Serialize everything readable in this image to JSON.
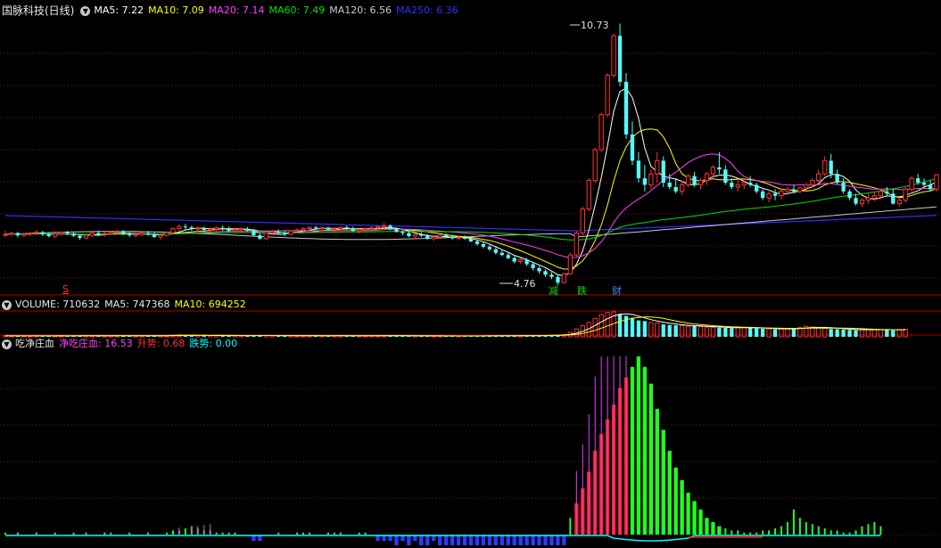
{
  "price_panel": {
    "stock_name": "国脉科技(日线)",
    "indicators": [
      {
        "label": "MA5: 7.22",
        "color": "#ffffff"
      },
      {
        "label": "MA10: 7.09",
        "color": "#ffff00"
      },
      {
        "label": "MA20: 7.14",
        "color": "#ff40ff"
      },
      {
        "label": "MA60: 7.49",
        "color": "#00e000"
      },
      {
        "label": "MA120: 6.56",
        "color": "#c8c8c8"
      },
      {
        "label": "MA250: 6.36",
        "color": "#3030ff"
      }
    ],
    "high_label": "10.73",
    "low_label": "4.76",
    "markers": {
      "s_mark": "S",
      "jian": "减",
      "die": "跌",
      "cai": "财"
    }
  },
  "volume_panel": {
    "indicators": [
      {
        "label": "VOLUME: 710632",
        "color": "#ffffff"
      },
      {
        "label": "MA5: 747368",
        "color": "#ffffff"
      },
      {
        "label": "MA10: 694252",
        "color": "#ffff00"
      }
    ]
  },
  "indicator_panel": {
    "name": "吃净庄血",
    "indicators": [
      {
        "label": "净吃庄血: 16.53",
        "color": "#ff40ff"
      },
      {
        "label": "升势: 0.68",
        "color": "#ff3030"
      },
      {
        "label": "跌势: 0.00",
        "color": "#00ffff"
      }
    ]
  },
  "colors": {
    "up": "#ff3232",
    "down": "#54fcfc",
    "grid": "#801818",
    "separator": "#b40000"
  },
  "chart_data": {
    "type": "candlestick",
    "price_range": [
      4.76,
      10.73
    ],
    "ma_latest": {
      "MA5": 7.22,
      "MA10": 7.09,
      "MA20": 7.14,
      "MA60": 7.49,
      "MA120": 6.56,
      "MA250": 6.36
    },
    "candles": [
      [
        5.9,
        6.0,
        5.85,
        5.92
      ],
      [
        5.92,
        5.98,
        5.88,
        5.95
      ],
      [
        5.95,
        5.98,
        5.85,
        5.9
      ],
      [
        5.9,
        5.96,
        5.86,
        5.93
      ],
      [
        5.93,
        5.98,
        5.88,
        5.95
      ],
      [
        5.95,
        6.02,
        5.9,
        5.97
      ],
      [
        5.97,
        6.0,
        5.88,
        5.92
      ],
      [
        5.92,
        5.96,
        5.85,
        5.88
      ],
      [
        5.88,
        5.95,
        5.84,
        5.93
      ],
      [
        5.93,
        5.99,
        5.89,
        5.96
      ],
      [
        5.96,
        6.0,
        5.9,
        5.94
      ],
      [
        5.94,
        5.98,
        5.86,
        5.89
      ],
      [
        5.89,
        5.93,
        5.8,
        5.84
      ],
      [
        5.84,
        5.92,
        5.81,
        5.9
      ],
      [
        5.9,
        5.98,
        5.86,
        5.95
      ],
      [
        5.95,
        6.0,
        5.88,
        5.92
      ],
      [
        5.92,
        5.97,
        5.87,
        5.94
      ],
      [
        5.94,
        6.0,
        5.9,
        5.97
      ],
      [
        5.97,
        6.03,
        5.92,
        5.98
      ],
      [
        5.98,
        6.02,
        5.9,
        5.93
      ],
      [
        5.93,
        5.97,
        5.86,
        5.9
      ],
      [
        5.9,
        5.96,
        5.85,
        5.92
      ],
      [
        5.92,
        5.98,
        5.88,
        5.95
      ],
      [
        5.95,
        6.0,
        5.89,
        5.92
      ],
      [
        5.92,
        5.96,
        5.84,
        5.86
      ],
      [
        5.86,
        5.92,
        5.8,
        5.9
      ],
      [
        5.9,
        5.99,
        5.87,
        5.96
      ],
      [
        5.96,
        6.08,
        5.93,
        6.05
      ],
      [
        6.05,
        6.15,
        6.0,
        6.1
      ],
      [
        6.1,
        6.16,
        6.03,
        6.08
      ],
      [
        6.08,
        6.12,
        6.0,
        6.04
      ],
      [
        6.04,
        6.1,
        5.98,
        6.06
      ],
      [
        6.06,
        6.1,
        5.98,
        6.02
      ],
      [
        6.02,
        6.08,
        5.96,
        6.04
      ],
      [
        6.04,
        6.1,
        5.99,
        6.07
      ],
      [
        6.07,
        6.12,
        6.0,
        6.05
      ],
      [
        6.05,
        6.1,
        5.97,
        6.0
      ],
      [
        6.0,
        6.06,
        5.94,
        6.03
      ],
      [
        6.03,
        6.08,
        5.97,
        6.05
      ],
      [
        6.05,
        6.09,
        5.98,
        6.01
      ],
      [
        6.01,
        6.05,
        5.88,
        5.9
      ],
      [
        5.9,
        5.95,
        5.8,
        5.82
      ],
      [
        5.82,
        5.96,
        5.8,
        5.95
      ],
      [
        5.95,
        6.02,
        5.9,
        5.98
      ],
      [
        5.98,
        6.03,
        5.92,
        5.95
      ],
      [
        5.95,
        6.0,
        5.88,
        5.92
      ],
      [
        5.92,
        6.02,
        5.9,
        6.0
      ],
      [
        6.0,
        6.06,
        5.94,
        6.02
      ],
      [
        6.02,
        6.08,
        5.97,
        6.05
      ],
      [
        6.05,
        6.1,
        6.0,
        6.08
      ],
      [
        6.08,
        6.12,
        6.02,
        6.06
      ],
      [
        6.06,
        6.1,
        6.0,
        6.07
      ],
      [
        6.07,
        6.1,
        6.0,
        6.03
      ],
      [
        6.03,
        6.08,
        5.98,
        6.05
      ],
      [
        6.05,
        6.1,
        6.0,
        6.08
      ],
      [
        6.08,
        6.12,
        6.02,
        6.06
      ],
      [
        6.06,
        6.1,
        5.98,
        6.0
      ],
      [
        6.0,
        6.05,
        5.94,
        6.03
      ],
      [
        6.03,
        6.08,
        5.98,
        6.05
      ],
      [
        6.05,
        6.1,
        6.0,
        6.07
      ],
      [
        6.07,
        6.12,
        6.02,
        6.09
      ],
      [
        6.09,
        6.18,
        6.05,
        6.12
      ],
      [
        6.12,
        6.15,
        6.02,
        6.04
      ],
      [
        6.04,
        6.08,
        5.96,
        5.98
      ],
      [
        5.98,
        6.02,
        5.9,
        5.95
      ],
      [
        5.95,
        6.0,
        5.85,
        5.88
      ],
      [
        5.88,
        5.94,
        5.82,
        5.92
      ],
      [
        5.92,
        5.97,
        5.86,
        5.89
      ],
      [
        5.89,
        5.93,
        5.8,
        5.82
      ],
      [
        5.82,
        5.9,
        5.78,
        5.86
      ],
      [
        5.86,
        5.92,
        5.82,
        5.9
      ],
      [
        5.9,
        5.95,
        5.84,
        5.87
      ],
      [
        5.87,
        5.91,
        5.8,
        5.83
      ],
      [
        5.83,
        5.88,
        5.78,
        5.85
      ],
      [
        5.85,
        5.9,
        5.8,
        5.82
      ],
      [
        5.82,
        5.86,
        5.74,
        5.76
      ],
      [
        5.76,
        5.8,
        5.66,
        5.7
      ],
      [
        5.7,
        5.74,
        5.6,
        5.64
      ],
      [
        5.64,
        5.68,
        5.54,
        5.58
      ],
      [
        5.58,
        5.62,
        5.46,
        5.5
      ],
      [
        5.5,
        5.56,
        5.42,
        5.45
      ],
      [
        5.45,
        5.5,
        5.35,
        5.38
      ],
      [
        5.38,
        5.42,
        5.26,
        5.3
      ],
      [
        5.3,
        5.38,
        5.24,
        5.34
      ],
      [
        5.34,
        5.38,
        5.2,
        5.24
      ],
      [
        5.24,
        5.28,
        5.1,
        5.15
      ],
      [
        5.15,
        5.2,
        5.02,
        5.08
      ],
      [
        5.08,
        5.12,
        4.95,
        5.0
      ],
      [
        5.0,
        5.06,
        4.9,
        4.95
      ],
      [
        4.95,
        5.0,
        4.76,
        4.82
      ],
      [
        4.82,
        5.05,
        4.8,
        5.02
      ],
      [
        5.02,
        5.5,
        5.0,
        5.45
      ],
      [
        5.45,
        6.0,
        5.42,
        5.95
      ],
      [
        5.95,
        6.55,
        5.9,
        6.5
      ],
      [
        6.5,
        7.2,
        6.45,
        7.15
      ],
      [
        7.15,
        7.9,
        7.1,
        7.85
      ],
      [
        7.85,
        8.7,
        7.8,
        8.65
      ],
      [
        8.65,
        9.6,
        8.6,
        9.55
      ],
      [
        9.55,
        10.5,
        9.5,
        10.45
      ],
      [
        10.45,
        10.73,
        9.3,
        9.4
      ],
      [
        9.4,
        9.6,
        8.1,
        8.2
      ],
      [
        8.2,
        8.5,
        7.5,
        7.6
      ],
      [
        7.6,
        7.8,
        7.1,
        7.2
      ],
      [
        7.2,
        7.5,
        6.9,
        7.05
      ],
      [
        7.05,
        7.4,
        6.95,
        7.3
      ],
      [
        7.3,
        7.8,
        7.1,
        7.6
      ],
      [
        7.6,
        7.7,
        7.0,
        7.1
      ],
      [
        7.1,
        7.3,
        6.95,
        7.0
      ],
      [
        7.0,
        7.2,
        6.85,
        6.9
      ],
      [
        6.9,
        7.15,
        6.82,
        7.05
      ],
      [
        7.05,
        7.3,
        7.0,
        7.25
      ],
      [
        7.25,
        7.35,
        7.0,
        7.05
      ],
      [
        7.05,
        7.2,
        6.95,
        7.15
      ],
      [
        7.15,
        7.35,
        7.05,
        7.3
      ],
      [
        7.3,
        7.5,
        7.2,
        7.45
      ],
      [
        7.45,
        7.8,
        7.3,
        7.4
      ],
      [
        7.4,
        7.5,
        7.05,
        7.1
      ],
      [
        7.1,
        7.2,
        6.95,
        7.0
      ],
      [
        7.0,
        7.15,
        6.9,
        7.05
      ],
      [
        7.05,
        7.2,
        6.95,
        7.1
      ],
      [
        7.1,
        7.25,
        7.0,
        7.05
      ],
      [
        7.05,
        7.1,
        6.85,
        6.9
      ],
      [
        6.9,
        6.95,
        6.7,
        6.75
      ],
      [
        6.75,
        6.9,
        6.65,
        6.85
      ],
      [
        6.85,
        6.95,
        6.7,
        6.8
      ],
      [
        6.8,
        6.95,
        6.72,
        6.9
      ],
      [
        6.9,
        7.0,
        6.82,
        6.95
      ],
      [
        6.95,
        7.05,
        6.85,
        6.9
      ],
      [
        6.9,
        7.0,
        6.85,
        6.98
      ],
      [
        6.98,
        7.1,
        6.92,
        7.05
      ],
      [
        7.05,
        7.2,
        7.0,
        7.15
      ],
      [
        7.15,
        7.4,
        7.1,
        7.3
      ],
      [
        7.3,
        7.7,
        7.25,
        7.6
      ],
      [
        7.6,
        7.75,
        7.2,
        7.3
      ],
      [
        7.3,
        7.4,
        7.05,
        7.1
      ],
      [
        7.1,
        7.2,
        6.85,
        6.9
      ],
      [
        6.9,
        6.95,
        6.7,
        6.75
      ],
      [
        6.75,
        6.85,
        6.58,
        6.62
      ],
      [
        6.62,
        6.75,
        6.55,
        6.7
      ],
      [
        6.7,
        6.85,
        6.62,
        6.75
      ],
      [
        6.75,
        6.9,
        6.68,
        6.8
      ],
      [
        6.8,
        6.95,
        6.72,
        6.9
      ],
      [
        6.9,
        7.0,
        6.78,
        6.85
      ],
      [
        6.85,
        6.95,
        6.6,
        6.62
      ],
      [
        6.62,
        6.75,
        6.55,
        6.7
      ],
      [
        6.7,
        7.0,
        6.65,
        6.95
      ],
      [
        6.95,
        7.25,
        6.9,
        7.2
      ],
      [
        7.2,
        7.3,
        7.05,
        7.1
      ],
      [
        7.1,
        7.2,
        6.98,
        7.05
      ],
      [
        7.05,
        7.15,
        6.9,
        6.95
      ],
      [
        6.95,
        7.3,
        6.9,
        7.28
      ]
    ],
    "volume": [
      8,
      7,
      8,
      6,
      7,
      9,
      8,
      7,
      8,
      9,
      7,
      8,
      9,
      10,
      8,
      7,
      8,
      9,
      10,
      9,
      8,
      7,
      8,
      9,
      8,
      9,
      11,
      14,
      15,
      12,
      11,
      10,
      9,
      10,
      11,
      10,
      9,
      10,
      9,
      8,
      12,
      11,
      10,
      9,
      8,
      9,
      10,
      9,
      8,
      9,
      10,
      9,
      8,
      9,
      10,
      9,
      8,
      7,
      8,
      9,
      10,
      11,
      10,
      9,
      8,
      7,
      8,
      7,
      6,
      7,
      8,
      7,
      6,
      7,
      6,
      7,
      8,
      9,
      8,
      9,
      10,
      9,
      8,
      9,
      10,
      11,
      10,
      12,
      13,
      14,
      18,
      35,
      60,
      85,
      110,
      140,
      170,
      185,
      190,
      175,
      160,
      140,
      125,
      120,
      110,
      105,
      95,
      90,
      88,
      85,
      80,
      82,
      78,
      75,
      72,
      70,
      68,
      66,
      70,
      72,
      68,
      65,
      62,
      60,
      58,
      60,
      62,
      65,
      70,
      80,
      75,
      70,
      65,
      60,
      58,
      55,
      52,
      50,
      55,
      58,
      56,
      54,
      52,
      50,
      55,
      58
    ],
    "indicator_bars": [
      1,
      0,
      1,
      0,
      0,
      1,
      0,
      0,
      1,
      0,
      0,
      1,
      0,
      1,
      0,
      0,
      1,
      1,
      0,
      0,
      1,
      0,
      0,
      1,
      0,
      0,
      1,
      2,
      2,
      3,
      4,
      3,
      2,
      2,
      1,
      1,
      1,
      1,
      0,
      0,
      -1,
      -1,
      0,
      0,
      1,
      0,
      0,
      1,
      1,
      1,
      0,
      0,
      1,
      1,
      1,
      0,
      0,
      1,
      1,
      0,
      -1,
      -1,
      -1,
      -2,
      -1,
      -2,
      -1,
      -2,
      -2,
      -1,
      -2,
      -2,
      -2,
      -3,
      -2,
      -3,
      -3,
      -3,
      -2,
      -2,
      -3,
      -3,
      -3,
      -4,
      -4,
      -4,
      -5,
      -4,
      -4,
      -3,
      -2,
      8,
      15,
      22,
      30,
      40,
      48,
      55,
      62,
      70,
      75,
      80,
      85,
      80,
      72,
      60,
      50,
      40,
      32,
      26,
      20,
      16,
      12,
      8,
      6,
      4,
      3,
      2,
      2,
      1,
      1,
      1,
      2,
      2,
      3,
      4,
      6,
      12,
      8,
      6,
      5,
      4,
      3,
      2,
      2,
      1,
      1,
      2,
      4,
      5,
      6,
      4
    ]
  }
}
